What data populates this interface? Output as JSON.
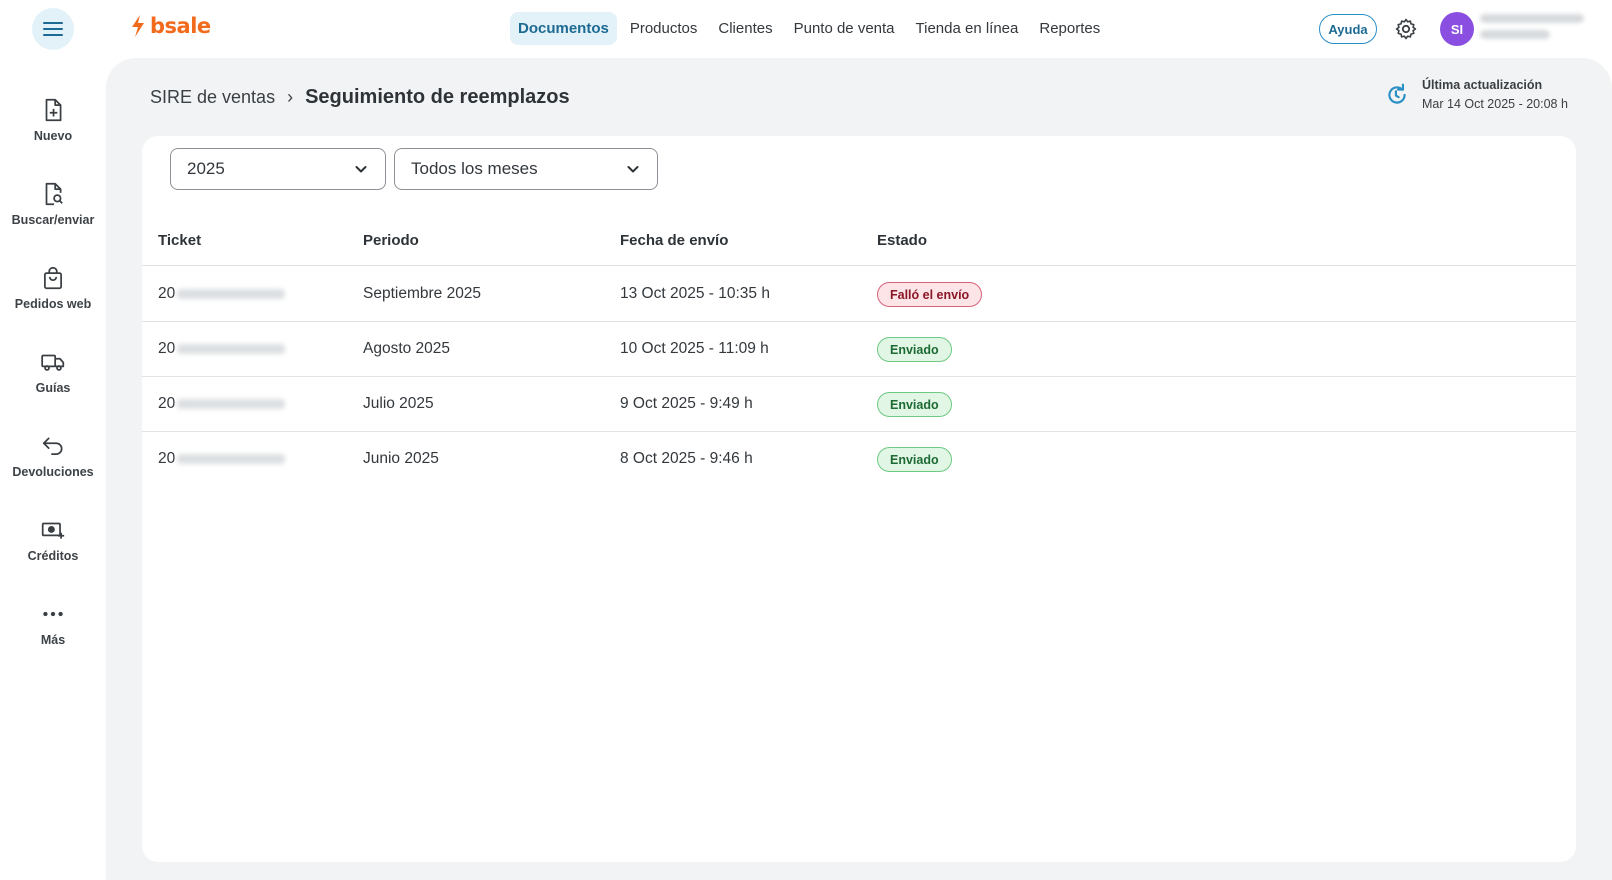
{
  "brand": {
    "name": "bsale"
  },
  "nav": {
    "items": [
      {
        "label": "Documentos",
        "active": true
      },
      {
        "label": "Productos"
      },
      {
        "label": "Clientes"
      },
      {
        "label": "Punto de venta"
      },
      {
        "label": "Tienda en línea"
      },
      {
        "label": "Reportes"
      }
    ]
  },
  "header": {
    "help_label": "Ayuda",
    "avatar_initials": "SI"
  },
  "sidebar": {
    "items": [
      {
        "label": "Nuevo",
        "icon": "file-plus-icon"
      },
      {
        "label": "Buscar/enviar",
        "icon": "file-search-icon"
      },
      {
        "label": "Pedidos web",
        "icon": "shopping-bag-icon"
      },
      {
        "label": "Guías",
        "icon": "truck-icon"
      },
      {
        "label": "Devoluciones",
        "icon": "return-arrow-icon"
      },
      {
        "label": "Créditos",
        "icon": "money-plus-icon"
      },
      {
        "label": "Más",
        "icon": "more-dots-icon"
      }
    ]
  },
  "breadcrumb": {
    "parent": "SIRE de ventas",
    "separator": "›",
    "current": "Seguimiento de reemplazos"
  },
  "update": {
    "title": "Última actualización",
    "date": "Mar 14 Oct 2025 - 20:08 h"
  },
  "filters": {
    "year": "2025",
    "month": "Todos los meses"
  },
  "table": {
    "headers": {
      "ticket": "Ticket",
      "period": "Periodo",
      "date": "Fecha de envío",
      "status": "Estado"
    },
    "rows": [
      {
        "ticket_prefix": "20",
        "period": "Septiembre 2025",
        "date": "13 Oct 2025 - 10:35 h",
        "status": "Falló el envío",
        "status_type": "fail"
      },
      {
        "ticket_prefix": "20",
        "period": "Agosto 2025",
        "date": "10 Oct 2025 - 11:09 h",
        "status": "Enviado",
        "status_type": "ok"
      },
      {
        "ticket_prefix": "20",
        "period": "Julio 2025",
        "date": "9 Oct 2025 - 9:49 h",
        "status": "Enviado",
        "status_type": "ok"
      },
      {
        "ticket_prefix": "20",
        "period": "Junio 2025",
        "date": "8 Oct 2025 - 9:46 h",
        "status": "Enviado",
        "status_type": "ok"
      }
    ]
  },
  "colors": {
    "accent": "#1d6a93",
    "brand": "#f26b1d",
    "avatar": "#8a4fe0",
    "fail": "#8a1726",
    "ok": "#1d6a33"
  }
}
